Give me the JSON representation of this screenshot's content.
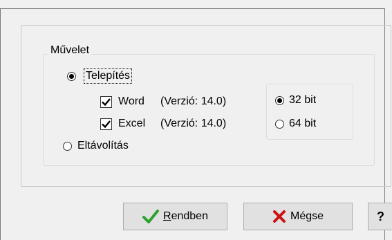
{
  "group": {
    "title": "Művelet"
  },
  "options": {
    "install": {
      "label": "Telepítés",
      "selected": true
    },
    "uninstall": {
      "label": "Eltávolítás",
      "selected": false
    }
  },
  "components": [
    {
      "name": "Word",
      "version": "(Verzió: 14.0)",
      "checked": true
    },
    {
      "name": "Excel",
      "version": "(Verzió: 14.0)",
      "checked": true
    }
  ],
  "bitness": {
    "bit32": {
      "label": "32 bit",
      "selected": true
    },
    "bit64": {
      "label": "64 bit",
      "selected": false
    }
  },
  "buttons": {
    "ok": {
      "mnemonic": "R",
      "rest": "endben"
    },
    "cancel": {
      "label": "Mégse"
    },
    "help": {
      "label": "?"
    }
  },
  "colors": {
    "check_green": "#2ea12e",
    "cancel_red": "#cc1111"
  }
}
